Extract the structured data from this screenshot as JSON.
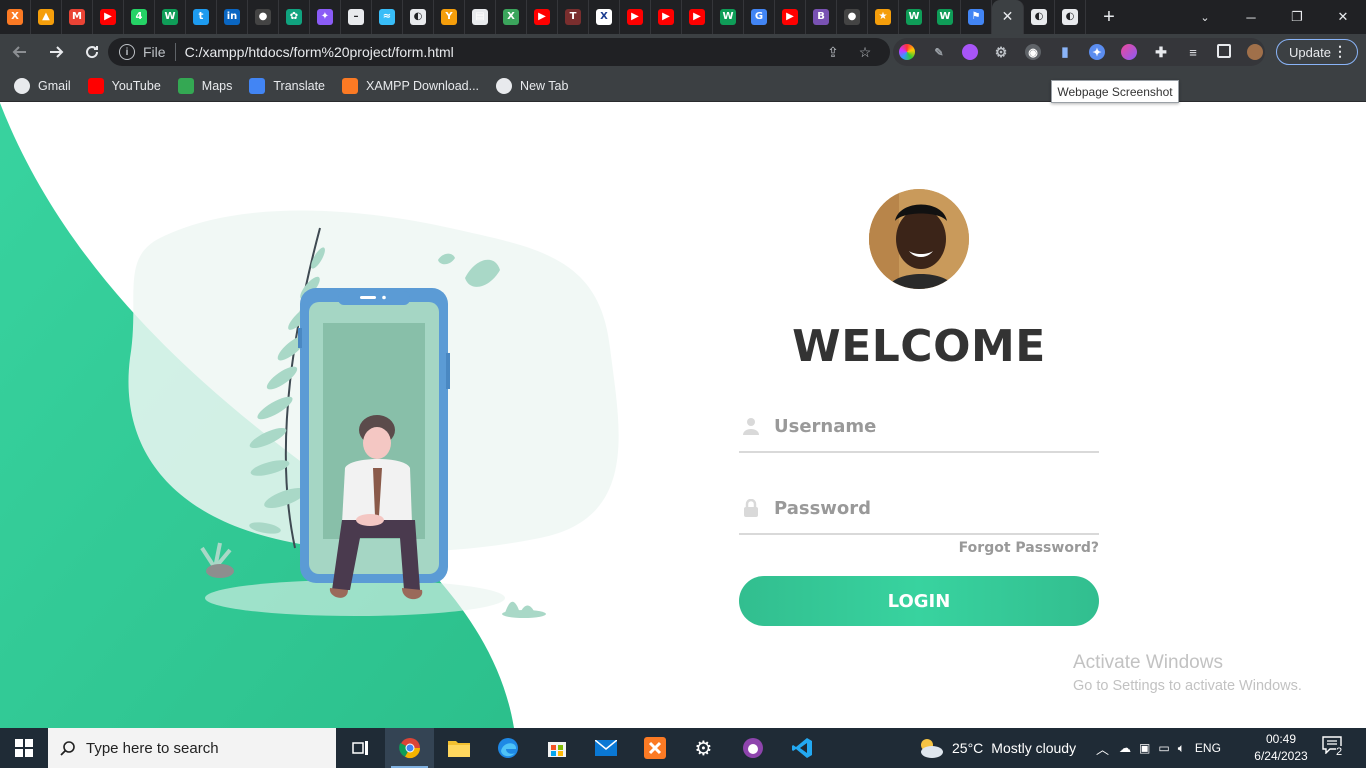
{
  "browser": {
    "tabs": [
      {
        "icon": "xampp-icon",
        "glyph": "X",
        "color": "#fb7a24"
      },
      {
        "icon": "warning-cone-icon",
        "glyph": "▲",
        "color": "#f59e0b"
      },
      {
        "icon": "gmail-icon",
        "glyph": "M",
        "color": "#ea4335"
      },
      {
        "icon": "youtube-icon",
        "glyph": "▶",
        "color": "#ff0000"
      },
      {
        "icon": "whatsapp-icon",
        "glyph": "4",
        "color": "#25d366"
      },
      {
        "icon": "wix-icon",
        "glyph": "W",
        "color": "#0f9d58"
      },
      {
        "icon": "twitter-icon",
        "glyph": "t",
        "color": "#1d9bf0"
      },
      {
        "icon": "linkedin-icon",
        "glyph": "in",
        "color": "#0a66c2"
      },
      {
        "icon": "github-icon",
        "glyph": "●",
        "color": "#444"
      },
      {
        "icon": "chatgpt-icon",
        "glyph": "✿",
        "color": "#10a37f"
      },
      {
        "icon": "sparkle-icon",
        "glyph": "✦",
        "color": "#8b5cf6"
      },
      {
        "icon": "dash-icon",
        "glyph": "–",
        "color": "#202124"
      },
      {
        "icon": "tailwind-icon",
        "glyph": "≈",
        "color": "#38bdf8"
      },
      {
        "icon": "globe-icon",
        "glyph": "◐",
        "color": "#202124"
      },
      {
        "icon": "y-icon",
        "glyph": "Y",
        "color": "#f59e0b"
      },
      {
        "icon": "docs-icon",
        "glyph": "▤",
        "color": "#e8eaed"
      },
      {
        "icon": "x-close-green-icon",
        "glyph": "X",
        "color": "#3ba55c"
      },
      {
        "icon": "youtube-icon",
        "glyph": "▶",
        "color": "#ff0000"
      },
      {
        "icon": "topten-icon",
        "glyph": "T",
        "color": "#7a2e2e"
      },
      {
        "icon": "x-logo-icon",
        "glyph": "X",
        "color": "#ffffff"
      },
      {
        "icon": "youtube-icon",
        "glyph": "▶",
        "color": "#ff0000"
      },
      {
        "icon": "youtube-icon",
        "glyph": "▶",
        "color": "#ff0000"
      },
      {
        "icon": "youtube-icon",
        "glyph": "▶",
        "color": "#ff0000"
      },
      {
        "icon": "wix-icon",
        "glyph": "W",
        "color": "#0f9d58"
      },
      {
        "icon": "google-icon",
        "glyph": "G",
        "color": "#4285f4"
      },
      {
        "icon": "youtube-icon",
        "glyph": "▶",
        "color": "#ff0000"
      },
      {
        "icon": "bootstrap-icon",
        "glyph": "B",
        "color": "#7952b3"
      },
      {
        "icon": "github-icon",
        "glyph": "●",
        "color": "#444"
      },
      {
        "icon": "star-icon",
        "glyph": "★",
        "color": "#f59e0b"
      },
      {
        "icon": "wix-icon",
        "glyph": "W",
        "color": "#0f9d58"
      },
      {
        "icon": "wix-icon",
        "glyph": "W",
        "color": "#0f9d58"
      },
      {
        "icon": "flag-icon",
        "glyph": "⚑",
        "color": "#4285f4"
      },
      {
        "icon": "close-icon",
        "glyph": "✕",
        "color": "#e8eaed",
        "active": true
      },
      {
        "icon": "globe-icon",
        "glyph": "◐",
        "color": "#202124"
      },
      {
        "icon": "globe-icon",
        "glyph": "◐",
        "color": "#202124"
      }
    ],
    "new_tab_glyph": "+",
    "address": {
      "scheme": "File",
      "url": "C:/xampp/htdocs/form%20project/form.html"
    },
    "update_label": "Update",
    "bookmarks": [
      {
        "label": "Gmail",
        "icon": "globe-icon",
        "color": "#e8eaed"
      },
      {
        "label": "YouTube",
        "icon": "youtube-icon",
        "color": "#ff0000"
      },
      {
        "label": "Maps",
        "icon": "maps-icon",
        "color": "#34a853"
      },
      {
        "label": "Translate",
        "icon": "translate-icon",
        "color": "#4285f4"
      },
      {
        "label": "XAMPP Download...",
        "icon": "xampp-icon",
        "color": "#fb7a24"
      },
      {
        "label": "New Tab",
        "icon": "globe-icon",
        "color": "#e8eaed"
      }
    ],
    "tooltip": "Webpage Screenshot"
  },
  "page": {
    "title": "WELCOME",
    "username_placeholder": "Username",
    "password_placeholder": "Password",
    "forgot_label": "Forgot Password?",
    "login_label": "LOGIN",
    "accent": "#38d39f"
  },
  "watermark": {
    "line1": "Activate Windows",
    "line2": "Go to Settings to activate Windows."
  },
  "taskbar": {
    "search_placeholder": "Type here to search",
    "weather_temp": "25°C",
    "weather_desc": "Mostly cloudy",
    "language": "ENG",
    "time": "00:49",
    "date": "6/24/2023",
    "notification_count": "2"
  }
}
